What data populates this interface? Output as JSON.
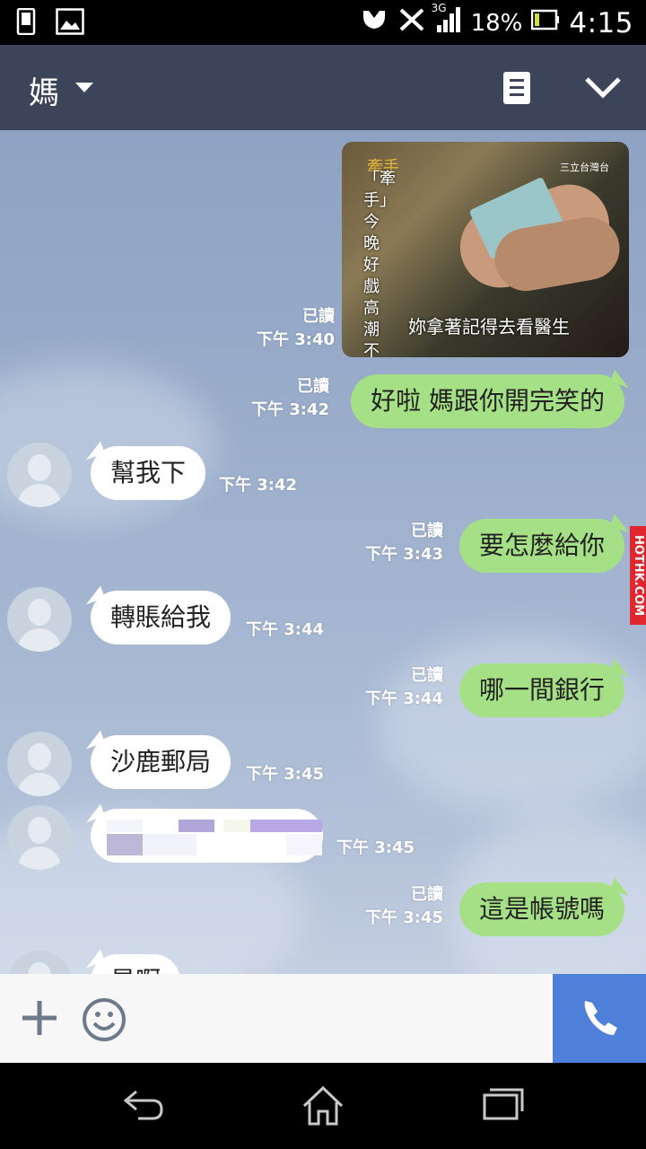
{
  "status_bar": {
    "network": "3G",
    "battery": "18%",
    "time": "4:15",
    "icons": [
      "phone-icon",
      "image-icon",
      "alarm-icon",
      "muted-icon",
      "signal-icon",
      "battery-icon"
    ]
  },
  "header": {
    "title": "媽",
    "icons": [
      "dropdown-caret-icon",
      "note-icon",
      "collapse-chevron-icon"
    ]
  },
  "messages": [
    {
      "side": "out",
      "type": "image",
      "read": "已讀",
      "time": "下午 3:40",
      "image_text": {
        "tag": "牽手",
        "vertical": "「牽手」今晚好戲高潮不",
        "caption": "妳拿著記得去看醫生",
        "logo": "三立台灣台"
      }
    },
    {
      "side": "out",
      "type": "text",
      "text": "好啦 媽跟你開完笑的",
      "read": "已讀",
      "time": "下午 3:42"
    },
    {
      "side": "in",
      "type": "text",
      "text": "幫我下",
      "time": "下午 3:42"
    },
    {
      "side": "out",
      "type": "text",
      "text": "要怎麼給你",
      "read": "已讀",
      "time": "下午 3:43"
    },
    {
      "side": "in",
      "type": "text",
      "text": "轉賬給我",
      "time": "下午 3:44"
    },
    {
      "side": "out",
      "type": "text",
      "text": "哪一間銀行",
      "read": "已讀",
      "time": "下午 3:44"
    },
    {
      "side": "in",
      "type": "text",
      "text": "沙鹿郵局",
      "time": "下午 3:45"
    },
    {
      "side": "in",
      "type": "censored",
      "text": "",
      "time": "下午 3:45"
    },
    {
      "side": "out",
      "type": "text",
      "text": "這是帳號嗎",
      "read": "已讀",
      "time": "下午 3:45"
    },
    {
      "side": "in",
      "type": "text",
      "text": "是啊",
      "time": ""
    }
  ],
  "watermark": "HOTHK.COM",
  "input_bar": {
    "icons": [
      "plus-icon",
      "emoji-icon",
      "phone-call-icon"
    ]
  },
  "nav_bar": {
    "icons": [
      "back-icon",
      "home-icon",
      "recent-apps-icon"
    ]
  },
  "colors": {
    "header_bg": "#3b4458",
    "outgoing_bubble": "#a6e086",
    "incoming_bubble": "#ffffff",
    "call_button": "#4e7fd9",
    "watermark_bg": "#e0262e"
  }
}
